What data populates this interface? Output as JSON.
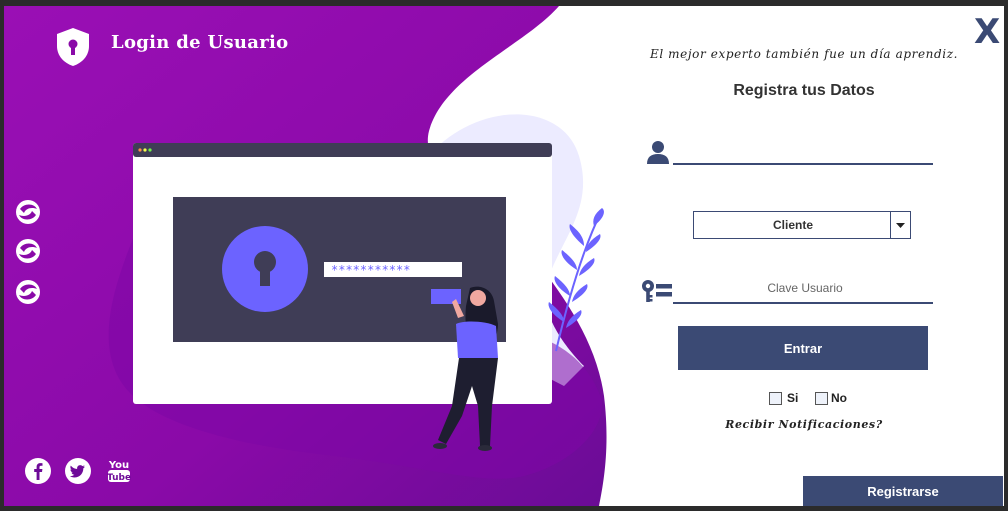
{
  "window": {
    "title": "Login de Usuario",
    "close_label": "X"
  },
  "illustration": {
    "password_mask": "***********"
  },
  "form": {
    "quote": "El mejor experto también fue un día aprendiz.",
    "heading": "Registra tus Datos",
    "username_value": "",
    "role_selected": "Cliente",
    "password_placeholder": "Clave Usuario",
    "submit_label": "Entrar",
    "options": [
      {
        "label": "Si",
        "checked": false
      },
      {
        "label": "No",
        "checked": false
      }
    ],
    "notifications_label": "Recibir Notificaciones?",
    "register_label": "Registrarse"
  },
  "colors": {
    "purple_dark": "#7b0f9a",
    "purple_light": "#a10ab3",
    "accent_violet": "#6c63ff",
    "navy": "#3b4a74",
    "screen_dark": "#3f3d56"
  },
  "icons": {
    "logo": "shield-lock-icon",
    "side": [
      "swirl-icon",
      "swirl-icon",
      "swirl-icon"
    ],
    "social": [
      "facebook-icon",
      "twitter-icon",
      "youtube-icon"
    ],
    "user_field": "user-icon",
    "password_field": "key-icon",
    "dropdown": "caret-down-icon"
  }
}
